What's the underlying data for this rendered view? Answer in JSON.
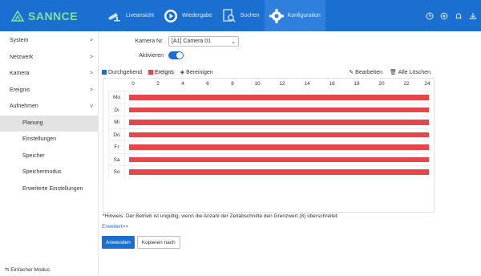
{
  "brand": {
    "name": "SANNCE"
  },
  "nav": [
    {
      "label": "Liveansicht",
      "icon": "camera-icon"
    },
    {
      "label": "Wiedergabe",
      "icon": "playback-icon"
    },
    {
      "label": "Suchen",
      "icon": "search-icon"
    },
    {
      "label": "Konfiguration",
      "icon": "gear-icon"
    }
  ],
  "top_icons": [
    "clock-icon",
    "settings-icon",
    "bell-icon",
    "download-icon"
  ],
  "sidebar": {
    "items": [
      {
        "label": "System",
        "chevron": ">"
      },
      {
        "label": "Netzwerk",
        "chevron": ">"
      },
      {
        "label": "Kamera",
        "chevron": ">"
      },
      {
        "label": "Ereignis",
        "chevron": ">"
      },
      {
        "label": "Aufnehmen",
        "chevron": "v"
      }
    ],
    "subitems": [
      {
        "label": "Planung"
      },
      {
        "label": "Einstellungen"
      },
      {
        "label": "Speicher"
      },
      {
        "label": "Speichermodus"
      },
      {
        "label": "Erweiterte Einstellungen"
      }
    ],
    "simple_mode": "Einfacher Modus"
  },
  "form": {
    "camera_label": "Kamera Nr.",
    "camera_value": "[A1] Camera 01",
    "activate_label": "Aktivieren",
    "activate_on": true
  },
  "legend": {
    "continuous": "Durchgehend",
    "event": "Ereigns",
    "clear": "Bereinigen",
    "continuous_color": "#1b6fd1",
    "event_color": "#e6454a"
  },
  "actions": {
    "edit": "Bearbeiten",
    "delete_all": "Alle Löschen"
  },
  "schedule": {
    "hours": [
      "0",
      "2",
      "4",
      "6",
      "8",
      "10",
      "12",
      "14",
      "16",
      "18",
      "20",
      "22",
      "24"
    ],
    "days": [
      "Mo",
      "Di",
      "Mi",
      "Do",
      "Fr",
      "Sa",
      "So"
    ],
    "bar_color": "#e6454a"
  },
  "hint": "*Hinweis: Der Betrieb ist ungültig, wenn die Anzahl der Zeitabschnitte den Grenzwert (8) überschreitet.",
  "advanced": "Erweitert>>",
  "buttons": {
    "apply": "Anwenden",
    "copy": "Kopieren nach"
  }
}
